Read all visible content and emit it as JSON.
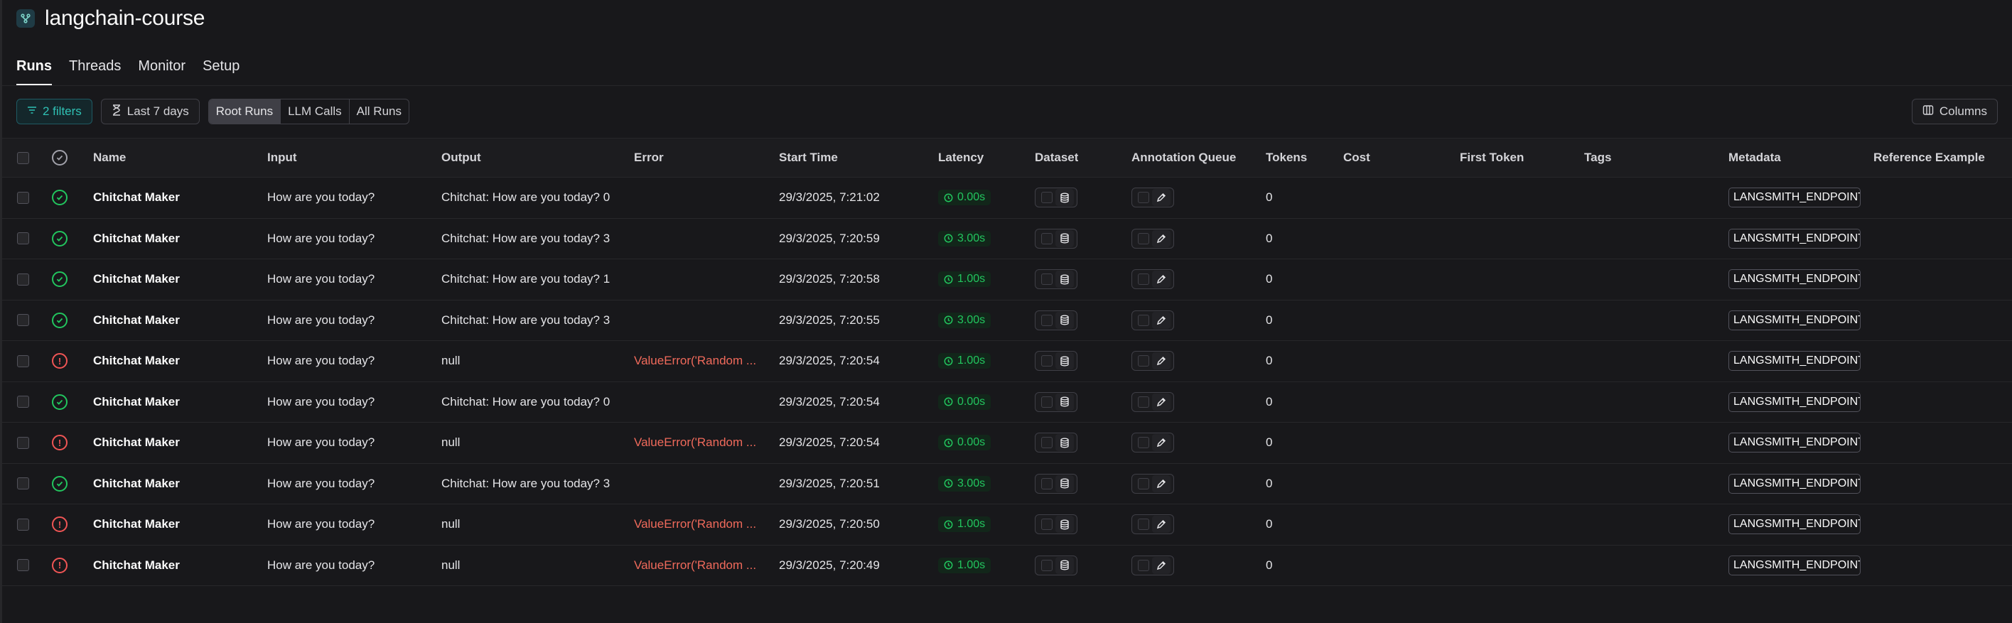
{
  "project": {
    "title": "langchain-course"
  },
  "tabs": [
    {
      "label": "Runs",
      "active": true
    },
    {
      "label": "Threads",
      "active": false
    },
    {
      "label": "Monitor",
      "active": false
    },
    {
      "label": "Setup",
      "active": false
    }
  ],
  "toolbar": {
    "filters_label": "2 filters",
    "time_label": "Last 7 days",
    "run_types": [
      {
        "label": "Root Runs",
        "active": true
      },
      {
        "label": "LLM Calls",
        "active": false
      },
      {
        "label": "All Runs",
        "active": false
      }
    ],
    "columns_label": "Columns"
  },
  "table": {
    "headers": {
      "name": "Name",
      "input": "Input",
      "output": "Output",
      "error": "Error",
      "start_time": "Start Time",
      "latency": "Latency",
      "dataset": "Dataset",
      "annotation_queue": "Annotation Queue",
      "tokens": "Tokens",
      "cost": "Cost",
      "first_token": "First Token",
      "tags": "Tags",
      "metadata": "Metadata",
      "reference_example": "Reference Example"
    },
    "rows": [
      {
        "status": "success",
        "name": "Chitchat Maker",
        "input": "How are you today?",
        "output": "Chitchat: How are you today? 0",
        "error": "",
        "start_time": "29/3/2025, 7:21:02",
        "latency": "0.00s",
        "tokens": "0",
        "metadata": "LANGSMITH_ENDPOINT"
      },
      {
        "status": "success",
        "name": "Chitchat Maker",
        "input": "How are you today?",
        "output": "Chitchat: How are you today? 3",
        "error": "",
        "start_time": "29/3/2025, 7:20:59",
        "latency": "3.00s",
        "tokens": "0",
        "metadata": "LANGSMITH_ENDPOINT"
      },
      {
        "status": "success",
        "name": "Chitchat Maker",
        "input": "How are you today?",
        "output": "Chitchat: How are you today? 1",
        "error": "",
        "start_time": "29/3/2025, 7:20:58",
        "latency": "1.00s",
        "tokens": "0",
        "metadata": "LANGSMITH_ENDPOINT"
      },
      {
        "status": "success",
        "name": "Chitchat Maker",
        "input": "How are you today?",
        "output": "Chitchat: How are you today? 3",
        "error": "",
        "start_time": "29/3/2025, 7:20:55",
        "latency": "3.00s",
        "tokens": "0",
        "metadata": "LANGSMITH_ENDPOINT"
      },
      {
        "status": "error",
        "name": "Chitchat Maker",
        "input": "How are you today?",
        "output": "null",
        "error": "ValueError('Random ...",
        "start_time": "29/3/2025, 7:20:54",
        "latency": "1.00s",
        "tokens": "0",
        "metadata": "LANGSMITH_ENDPOINT"
      },
      {
        "status": "success",
        "name": "Chitchat Maker",
        "input": "How are you today?",
        "output": "Chitchat: How are you today? 0",
        "error": "",
        "start_time": "29/3/2025, 7:20:54",
        "latency": "0.00s",
        "tokens": "0",
        "metadata": "LANGSMITH_ENDPOINT"
      },
      {
        "status": "error",
        "name": "Chitchat Maker",
        "input": "How are you today?",
        "output": "null",
        "error": "ValueError('Random ...",
        "start_time": "29/3/2025, 7:20:54",
        "latency": "0.00s",
        "tokens": "0",
        "metadata": "LANGSMITH_ENDPOINT"
      },
      {
        "status": "success",
        "name": "Chitchat Maker",
        "input": "How are you today?",
        "output": "Chitchat: How are you today? 3",
        "error": "",
        "start_time": "29/3/2025, 7:20:51",
        "latency": "3.00s",
        "tokens": "0",
        "metadata": "LANGSMITH_ENDPOINT"
      },
      {
        "status": "error",
        "name": "Chitchat Maker",
        "input": "How are you today?",
        "output": "null",
        "error": "ValueError('Random ...",
        "start_time": "29/3/2025, 7:20:50",
        "latency": "1.00s",
        "tokens": "0",
        "metadata": "LANGSMITH_ENDPOINT"
      },
      {
        "status": "error",
        "name": "Chitchat Maker",
        "input": "How are you today?",
        "output": "null",
        "error": "ValueError('Random ...",
        "start_time": "29/3/2025, 7:20:49",
        "latency": "1.00s",
        "tokens": "0",
        "metadata": "LANGSMITH_ENDPOINT"
      }
    ]
  },
  "colors": {
    "background": "#18181b",
    "accent_teal": "#2fc1b4",
    "success": "#22c55e",
    "error": "#f06a5b"
  },
  "icons": {
    "project": "project-graph-icon",
    "filter": "filter-icon",
    "time": "hourglass-icon",
    "columns": "columns-icon",
    "status_success": "check-circle-icon",
    "status_error": "alert-circle-icon",
    "latency": "clock-icon",
    "dataset": "database-icon",
    "annotation": "pencil-icon"
  }
}
